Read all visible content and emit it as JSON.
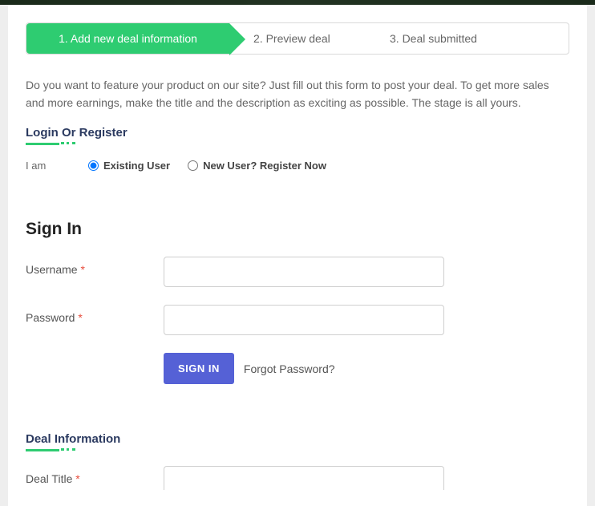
{
  "stepper": {
    "steps": [
      {
        "label": "1. Add new deal information"
      },
      {
        "label": "2. Preview deal"
      },
      {
        "label": "3. Deal submitted"
      }
    ]
  },
  "intro": "Do you want to feature your product on our site? Just fill out this form to post your deal. To get more sales and more earnings, make the title and the description as exciting as possible. The stage is all yours.",
  "login_section": {
    "title": "Login Or Register",
    "iam_label": "I am",
    "radios": {
      "existing": "Existing User",
      "new_user": "New User? Register Now"
    }
  },
  "signin": {
    "heading": "Sign In",
    "username_label": "Username",
    "password_label": "Password",
    "button": "SIGN IN",
    "forgot": "Forgot Password?"
  },
  "deal": {
    "title": "Deal Information",
    "deal_title_label": "Deal Title"
  },
  "required_mark": "*"
}
